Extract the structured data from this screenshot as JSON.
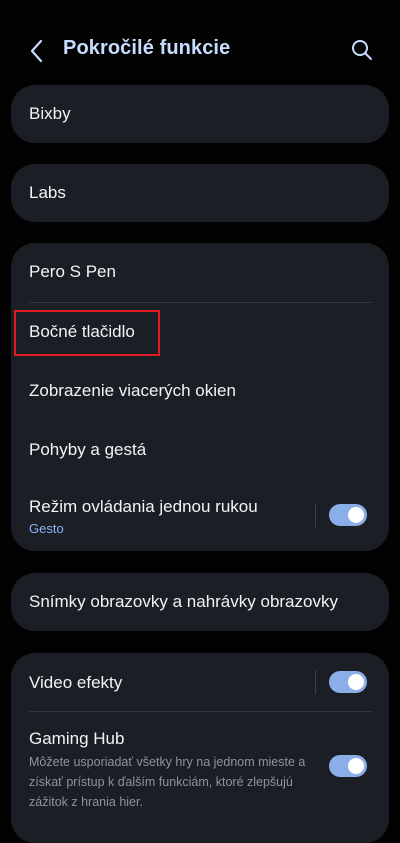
{
  "header": {
    "title": "Pokročilé funkcie",
    "back_icon": "chevron-left-icon",
    "search_icon": "search-icon"
  },
  "cards": {
    "bixby": "Bixby",
    "labs": "Labs",
    "group1": {
      "pero": "Pero S Pen",
      "bocne": "Bočné tlačidlo",
      "zobrazenie": "Zobrazenie viacerých okien",
      "pohyby": "Pohyby a gestá",
      "rezim": {
        "label": "Režim ovládania jednou rukou",
        "sub": "Gesto",
        "enabled": true
      }
    },
    "snimky": "Snímky obrazovky a nahrávky obrazovky",
    "group2": {
      "video": {
        "label": "Video efekty",
        "enabled": true
      },
      "gaming": {
        "label": "Gaming Hub",
        "desc": "Môžete usporiadať všetky hry na jednom mieste a získať prístup k ďalším funkciám, ktoré zlepšujú zážitok z hrania hier.",
        "enabled": true
      }
    }
  },
  "colors": {
    "title": "#c7dcff",
    "accent": "#8aaee8",
    "highlight": "#e01b24",
    "card": "#1b1f25",
    "background": "#020202"
  }
}
